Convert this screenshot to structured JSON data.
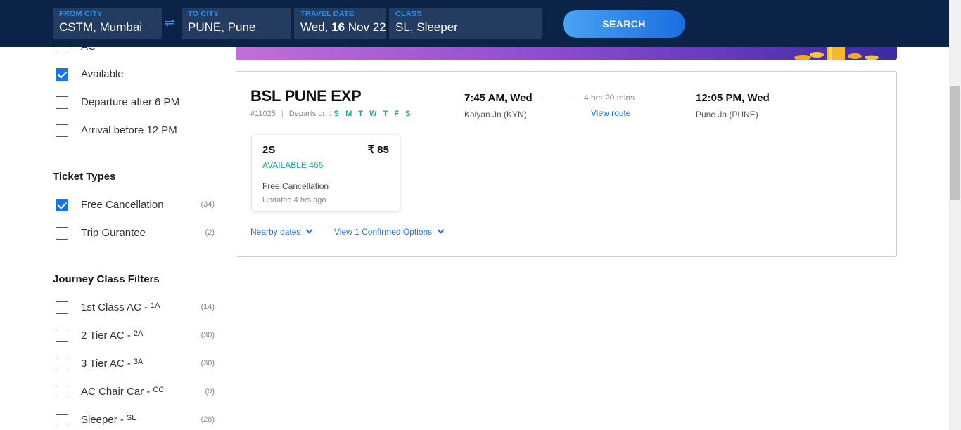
{
  "search": {
    "from": {
      "label": "FROM CITY",
      "value": "CSTM, Mumbai"
    },
    "to": {
      "label": "TO CITY",
      "value": "PUNE, Pune"
    },
    "date": {
      "label": "TRAVEL DATE",
      "weekday": "Wed,",
      "day": "16",
      "month_year": "Nov 22"
    },
    "class": {
      "label": "CLASS",
      "value": "SL, Sleeper"
    },
    "swap_icon": "⇌",
    "button_label": "SEARCH"
  },
  "sidebar": {
    "availability": [
      {
        "label": "AC",
        "checked": false
      },
      {
        "label": "Available",
        "checked": true
      },
      {
        "label": "Departure after 6 PM",
        "checked": false
      },
      {
        "label": "Arrival before 12 PM",
        "checked": false
      }
    ],
    "ticket_types": {
      "title": "Ticket Types",
      "items": [
        {
          "label": "Free Cancellation",
          "count": "(34)",
          "checked": true
        },
        {
          "label": "Trip Gurantee",
          "count": "(2)",
          "checked": false
        }
      ]
    },
    "journey_class": {
      "title": "Journey Class Filters",
      "items": [
        {
          "label": "1st Class AC -",
          "code": "1A",
          "count": "(14)",
          "checked": false
        },
        {
          "label": "2 Tier AC -",
          "code": "2A",
          "count": "(30)",
          "checked": false
        },
        {
          "label": "3 Tier AC -",
          "code": "3A",
          "count": "(30)",
          "checked": false
        },
        {
          "label": "AC Chair Car -",
          "code": "CC",
          "count": "(9)",
          "checked": false
        },
        {
          "label": "Sleeper -",
          "code": "SL",
          "count": "(28)",
          "checked": false
        }
      ]
    }
  },
  "train": {
    "name": "BSL PUNE EXP",
    "number": "#11025",
    "departs_label": "Departs on :",
    "days": "S M T W T F S",
    "departure_time": "7:45 AM, Wed",
    "departure_station": "Kalyan Jn (KYN)",
    "duration": "4 hrs 20 mins",
    "view_route": "View route",
    "arrival_time": "12:05 PM, Wed",
    "arrival_station": "Pune Jn (PUNE)",
    "class_option": {
      "class": "2S",
      "price": "₹ 85",
      "availability": "AVAILABLE 466",
      "cancellation": "Free Cancellation",
      "updated": "Updated 4 hrs ago"
    },
    "nearby_dates": "Nearby dates",
    "confirmed_options": "View 1 Confirmed Options"
  },
  "colors": {
    "header_bg": "#0b2347",
    "accent": "#1a73e8",
    "available": "#19a59b"
  }
}
